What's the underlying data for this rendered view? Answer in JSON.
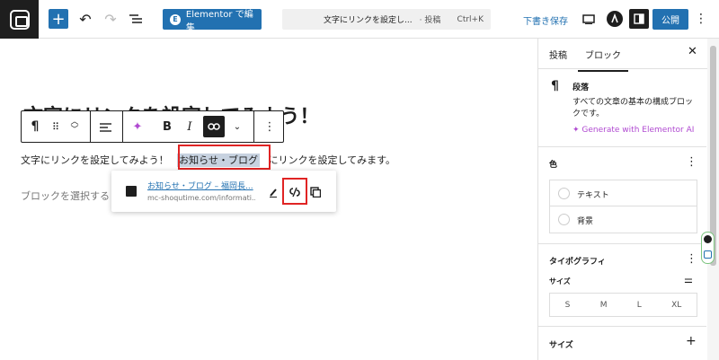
{
  "topbar": {
    "elementor_label": "Elementor で編集",
    "command_title": "文字にリンクを設定し...",
    "command_type": "· 投稿",
    "command_shortcut": "Ctrl+K",
    "draft_label": "下書き保存",
    "publish_label": "公開"
  },
  "editor": {
    "heading": "文字にリンクを設定してみよう！",
    "paragraph_before": "文字にリンクを設定してみよう！",
    "paragraph_link": "お知らせ・ブログ",
    "paragraph_after": "にリンクを設定してみます。",
    "placeholder": "ブロックを選択する"
  },
  "link_popover": {
    "title": "お知らせ・ブログ – 福岡長...",
    "url": "mc-shoqutime.com/informati..."
  },
  "sidebar": {
    "tab_post": "投稿",
    "tab_block": "ブロック",
    "block_name": "段落",
    "block_desc": "すべての文章の基本の構成ブロックです。",
    "ai_link": "Generate with Elementor AI",
    "color_title": "色",
    "color_text": "テキスト",
    "color_bg": "背景",
    "typo_title": "タイポグラフィ",
    "size_label": "サイズ",
    "sizes": [
      "S",
      "M",
      "L",
      "XL"
    ],
    "size_section": "サイズ"
  }
}
